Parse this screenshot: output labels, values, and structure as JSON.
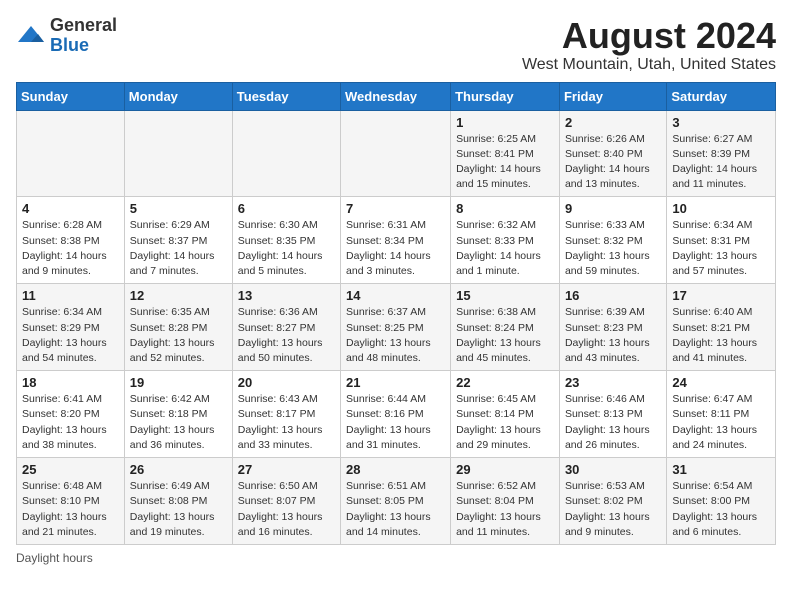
{
  "header": {
    "logo_general": "General",
    "logo_blue": "Blue",
    "title": "August 2024",
    "subtitle": "West Mountain, Utah, United States"
  },
  "days_of_week": [
    "Sunday",
    "Monday",
    "Tuesday",
    "Wednesday",
    "Thursday",
    "Friday",
    "Saturday"
  ],
  "weeks": [
    [
      {
        "day": "",
        "detail": ""
      },
      {
        "day": "",
        "detail": ""
      },
      {
        "day": "",
        "detail": ""
      },
      {
        "day": "",
        "detail": ""
      },
      {
        "day": "1",
        "detail": "Sunrise: 6:25 AM\nSunset: 8:41 PM\nDaylight: 14 hours and 15 minutes."
      },
      {
        "day": "2",
        "detail": "Sunrise: 6:26 AM\nSunset: 8:40 PM\nDaylight: 14 hours and 13 minutes."
      },
      {
        "day": "3",
        "detail": "Sunrise: 6:27 AM\nSunset: 8:39 PM\nDaylight: 14 hours and 11 minutes."
      }
    ],
    [
      {
        "day": "4",
        "detail": "Sunrise: 6:28 AM\nSunset: 8:38 PM\nDaylight: 14 hours and 9 minutes."
      },
      {
        "day": "5",
        "detail": "Sunrise: 6:29 AM\nSunset: 8:37 PM\nDaylight: 14 hours and 7 minutes."
      },
      {
        "day": "6",
        "detail": "Sunrise: 6:30 AM\nSunset: 8:35 PM\nDaylight: 14 hours and 5 minutes."
      },
      {
        "day": "7",
        "detail": "Sunrise: 6:31 AM\nSunset: 8:34 PM\nDaylight: 14 hours and 3 minutes."
      },
      {
        "day": "8",
        "detail": "Sunrise: 6:32 AM\nSunset: 8:33 PM\nDaylight: 14 hours and 1 minute."
      },
      {
        "day": "9",
        "detail": "Sunrise: 6:33 AM\nSunset: 8:32 PM\nDaylight: 13 hours and 59 minutes."
      },
      {
        "day": "10",
        "detail": "Sunrise: 6:34 AM\nSunset: 8:31 PM\nDaylight: 13 hours and 57 minutes."
      }
    ],
    [
      {
        "day": "11",
        "detail": "Sunrise: 6:34 AM\nSunset: 8:29 PM\nDaylight: 13 hours and 54 minutes."
      },
      {
        "day": "12",
        "detail": "Sunrise: 6:35 AM\nSunset: 8:28 PM\nDaylight: 13 hours and 52 minutes."
      },
      {
        "day": "13",
        "detail": "Sunrise: 6:36 AM\nSunset: 8:27 PM\nDaylight: 13 hours and 50 minutes."
      },
      {
        "day": "14",
        "detail": "Sunrise: 6:37 AM\nSunset: 8:25 PM\nDaylight: 13 hours and 48 minutes."
      },
      {
        "day": "15",
        "detail": "Sunrise: 6:38 AM\nSunset: 8:24 PM\nDaylight: 13 hours and 45 minutes."
      },
      {
        "day": "16",
        "detail": "Sunrise: 6:39 AM\nSunset: 8:23 PM\nDaylight: 13 hours and 43 minutes."
      },
      {
        "day": "17",
        "detail": "Sunrise: 6:40 AM\nSunset: 8:21 PM\nDaylight: 13 hours and 41 minutes."
      }
    ],
    [
      {
        "day": "18",
        "detail": "Sunrise: 6:41 AM\nSunset: 8:20 PM\nDaylight: 13 hours and 38 minutes."
      },
      {
        "day": "19",
        "detail": "Sunrise: 6:42 AM\nSunset: 8:18 PM\nDaylight: 13 hours and 36 minutes."
      },
      {
        "day": "20",
        "detail": "Sunrise: 6:43 AM\nSunset: 8:17 PM\nDaylight: 13 hours and 33 minutes."
      },
      {
        "day": "21",
        "detail": "Sunrise: 6:44 AM\nSunset: 8:16 PM\nDaylight: 13 hours and 31 minutes."
      },
      {
        "day": "22",
        "detail": "Sunrise: 6:45 AM\nSunset: 8:14 PM\nDaylight: 13 hours and 29 minutes."
      },
      {
        "day": "23",
        "detail": "Sunrise: 6:46 AM\nSunset: 8:13 PM\nDaylight: 13 hours and 26 minutes."
      },
      {
        "day": "24",
        "detail": "Sunrise: 6:47 AM\nSunset: 8:11 PM\nDaylight: 13 hours and 24 minutes."
      }
    ],
    [
      {
        "day": "25",
        "detail": "Sunrise: 6:48 AM\nSunset: 8:10 PM\nDaylight: 13 hours and 21 minutes."
      },
      {
        "day": "26",
        "detail": "Sunrise: 6:49 AM\nSunset: 8:08 PM\nDaylight: 13 hours and 19 minutes."
      },
      {
        "day": "27",
        "detail": "Sunrise: 6:50 AM\nSunset: 8:07 PM\nDaylight: 13 hours and 16 minutes."
      },
      {
        "day": "28",
        "detail": "Sunrise: 6:51 AM\nSunset: 8:05 PM\nDaylight: 13 hours and 14 minutes."
      },
      {
        "day": "29",
        "detail": "Sunrise: 6:52 AM\nSunset: 8:04 PM\nDaylight: 13 hours and 11 minutes."
      },
      {
        "day": "30",
        "detail": "Sunrise: 6:53 AM\nSunset: 8:02 PM\nDaylight: 13 hours and 9 minutes."
      },
      {
        "day": "31",
        "detail": "Sunrise: 6:54 AM\nSunset: 8:00 PM\nDaylight: 13 hours and 6 minutes."
      }
    ]
  ],
  "footer": {
    "note": "Daylight hours"
  }
}
